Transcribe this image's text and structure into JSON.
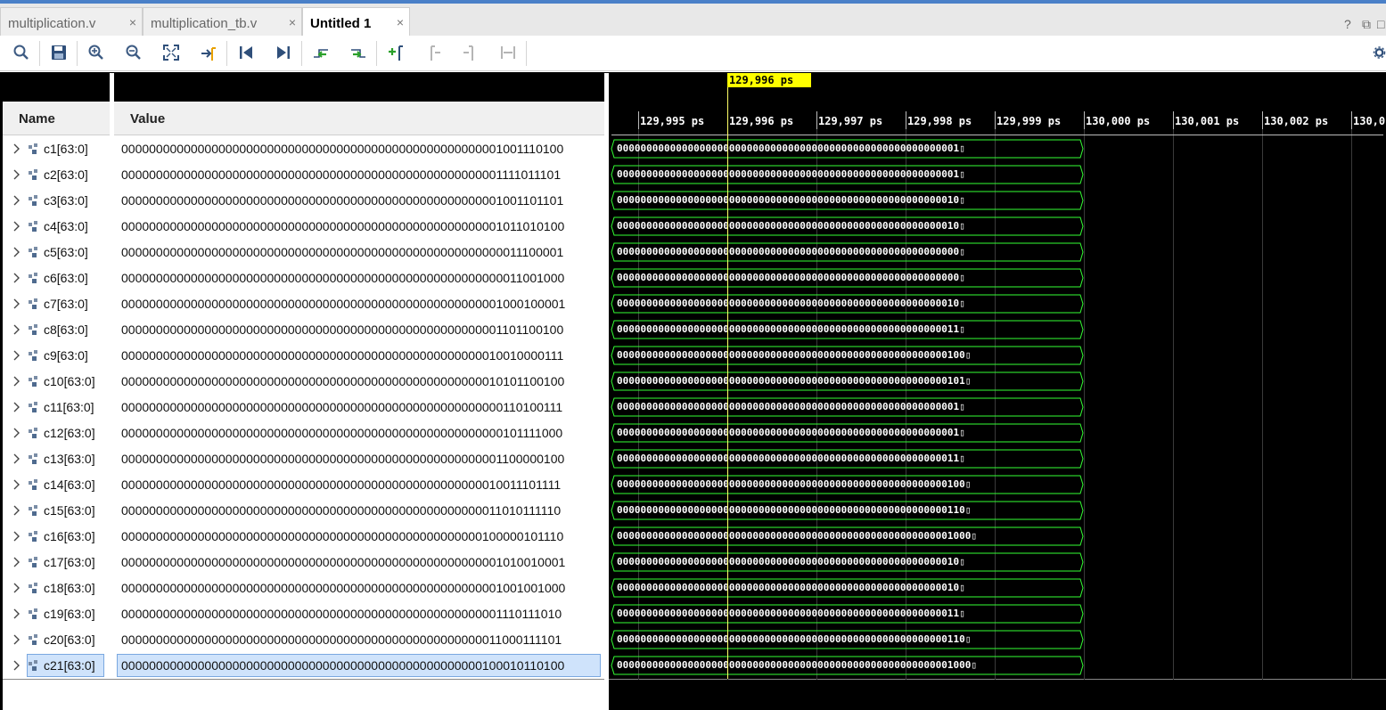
{
  "tabs": [
    {
      "label": "multiplication.v",
      "active": false
    },
    {
      "label": "multiplication_tb.v",
      "active": false
    },
    {
      "label": "Untitled 1",
      "active": true
    }
  ],
  "close_glyph": "×",
  "window_controls": [
    "?",
    "⧉",
    "□"
  ],
  "toolbar_icons": [
    "search-icon",
    "save-icon",
    "zoom-in-icon",
    "zoom-out-icon",
    "zoom-fit-icon",
    "go-to-cursor-icon",
    "go-to-time-zero-icon",
    "go-to-last-time-icon",
    "previous-transition-icon",
    "next-transition-icon",
    "add-marker-icon",
    "previous-marker-icon",
    "next-marker-icon",
    "swap-cursors-icon",
    "settings-icon"
  ],
  "columns": {
    "name": "Name",
    "value": "Value"
  },
  "cursor": {
    "label": "129,996 ps"
  },
  "ruler": {
    "ticks": [
      "129,995 ps",
      "129,996 ps",
      "129,997 ps",
      "129,998 ps",
      "129,999 ps",
      "130,000 ps",
      "130,001 ps",
      "130,002 ps",
      "130,0"
    ]
  },
  "signals": [
    {
      "name": "c1[63:0]",
      "value": "0000000000000000000000000000000000000000000000000000001001110100",
      "wave": "0000000000000000000000000000000000000000000000000000000001▯"
    },
    {
      "name": "c2[63:0]",
      "value": "0000000000000000000000000000000000000000000000000000001111011101",
      "wave": "0000000000000000000000000000000000000000000000000000000001▯"
    },
    {
      "name": "c3[63:0]",
      "value": "0000000000000000000000000000000000000000000000000000001001101101",
      "wave": "0000000000000000000000000000000000000000000000000000000010▯"
    },
    {
      "name": "c4[63:0]",
      "value": "0000000000000000000000000000000000000000000000000000001011010100",
      "wave": "0000000000000000000000000000000000000000000000000000000010▯"
    },
    {
      "name": "c5[63:0]",
      "value": "0000000000000000000000000000000000000000000000000000000011100001",
      "wave": "0000000000000000000000000000000000000000000000000000000000▯"
    },
    {
      "name": "c6[63:0]",
      "value": "0000000000000000000000000000000000000000000000000000000011001000",
      "wave": "0000000000000000000000000000000000000000000000000000000000▯"
    },
    {
      "name": "c7[63:0]",
      "value": "0000000000000000000000000000000000000000000000000000001000100001",
      "wave": "0000000000000000000000000000000000000000000000000000000010▯"
    },
    {
      "name": "c8[63:0]",
      "value": "0000000000000000000000000000000000000000000000000000001101100100",
      "wave": "0000000000000000000000000000000000000000000000000000000011▯"
    },
    {
      "name": "c9[63:0]",
      "value": "0000000000000000000000000000000000000000000000000000010010000111",
      "wave": "00000000000000000000000000000000000000000000000000000000100▯"
    },
    {
      "name": "c10[63:0]",
      "value": "0000000000000000000000000000000000000000000000000000010101100100",
      "wave": "00000000000000000000000000000000000000000000000000000000101▯"
    },
    {
      "name": "c11[63:0]",
      "value": "0000000000000000000000000000000000000000000000000000000110100111",
      "wave": "0000000000000000000000000000000000000000000000000000000001▯"
    },
    {
      "name": "c12[63:0]",
      "value": "0000000000000000000000000000000000000000000000000000000101111000",
      "wave": "0000000000000000000000000000000000000000000000000000000001▯"
    },
    {
      "name": "c13[63:0]",
      "value": "0000000000000000000000000000000000000000000000000000001100000100",
      "wave": "0000000000000000000000000000000000000000000000000000000011▯"
    },
    {
      "name": "c14[63:0]",
      "value": "0000000000000000000000000000000000000000000000000000010011101111",
      "wave": "00000000000000000000000000000000000000000000000000000000100▯"
    },
    {
      "name": "c15[63:0]",
      "value": "0000000000000000000000000000000000000000000000000000011010111110",
      "wave": "00000000000000000000000000000000000000000000000000000000110▯"
    },
    {
      "name": "c16[63:0]",
      "value": "0000000000000000000000000000000000000000000000000000100000101110",
      "wave": "000000000000000000000000000000000000000000000000000000001000▯"
    },
    {
      "name": "c17[63:0]",
      "value": "0000000000000000000000000000000000000000000000000000001010010001",
      "wave": "0000000000000000000000000000000000000000000000000000000010▯"
    },
    {
      "name": "c18[63:0]",
      "value": "0000000000000000000000000000000000000000000000000000001001001000",
      "wave": "0000000000000000000000000000000000000000000000000000000010▯"
    },
    {
      "name": "c19[63:0]",
      "value": "0000000000000000000000000000000000000000000000000000001110111010",
      "wave": "0000000000000000000000000000000000000000000000000000000011▯"
    },
    {
      "name": "c20[63:0]",
      "value": "0000000000000000000000000000000000000000000000000000011000111101",
      "wave": "00000000000000000000000000000000000000000000000000000000110▯"
    },
    {
      "name": "c21[63:0]",
      "value": "0000000000000000000000000000000000000000000000000000100010110100",
      "wave": "000000000000000000000000000000000000000000000000000000001000▯",
      "selected": true
    }
  ],
  "colors": {
    "wave": "#33ff33",
    "cursor": "#ffff00",
    "selection": "#cfe3fb",
    "tab_strip": "#4a80c8"
  }
}
